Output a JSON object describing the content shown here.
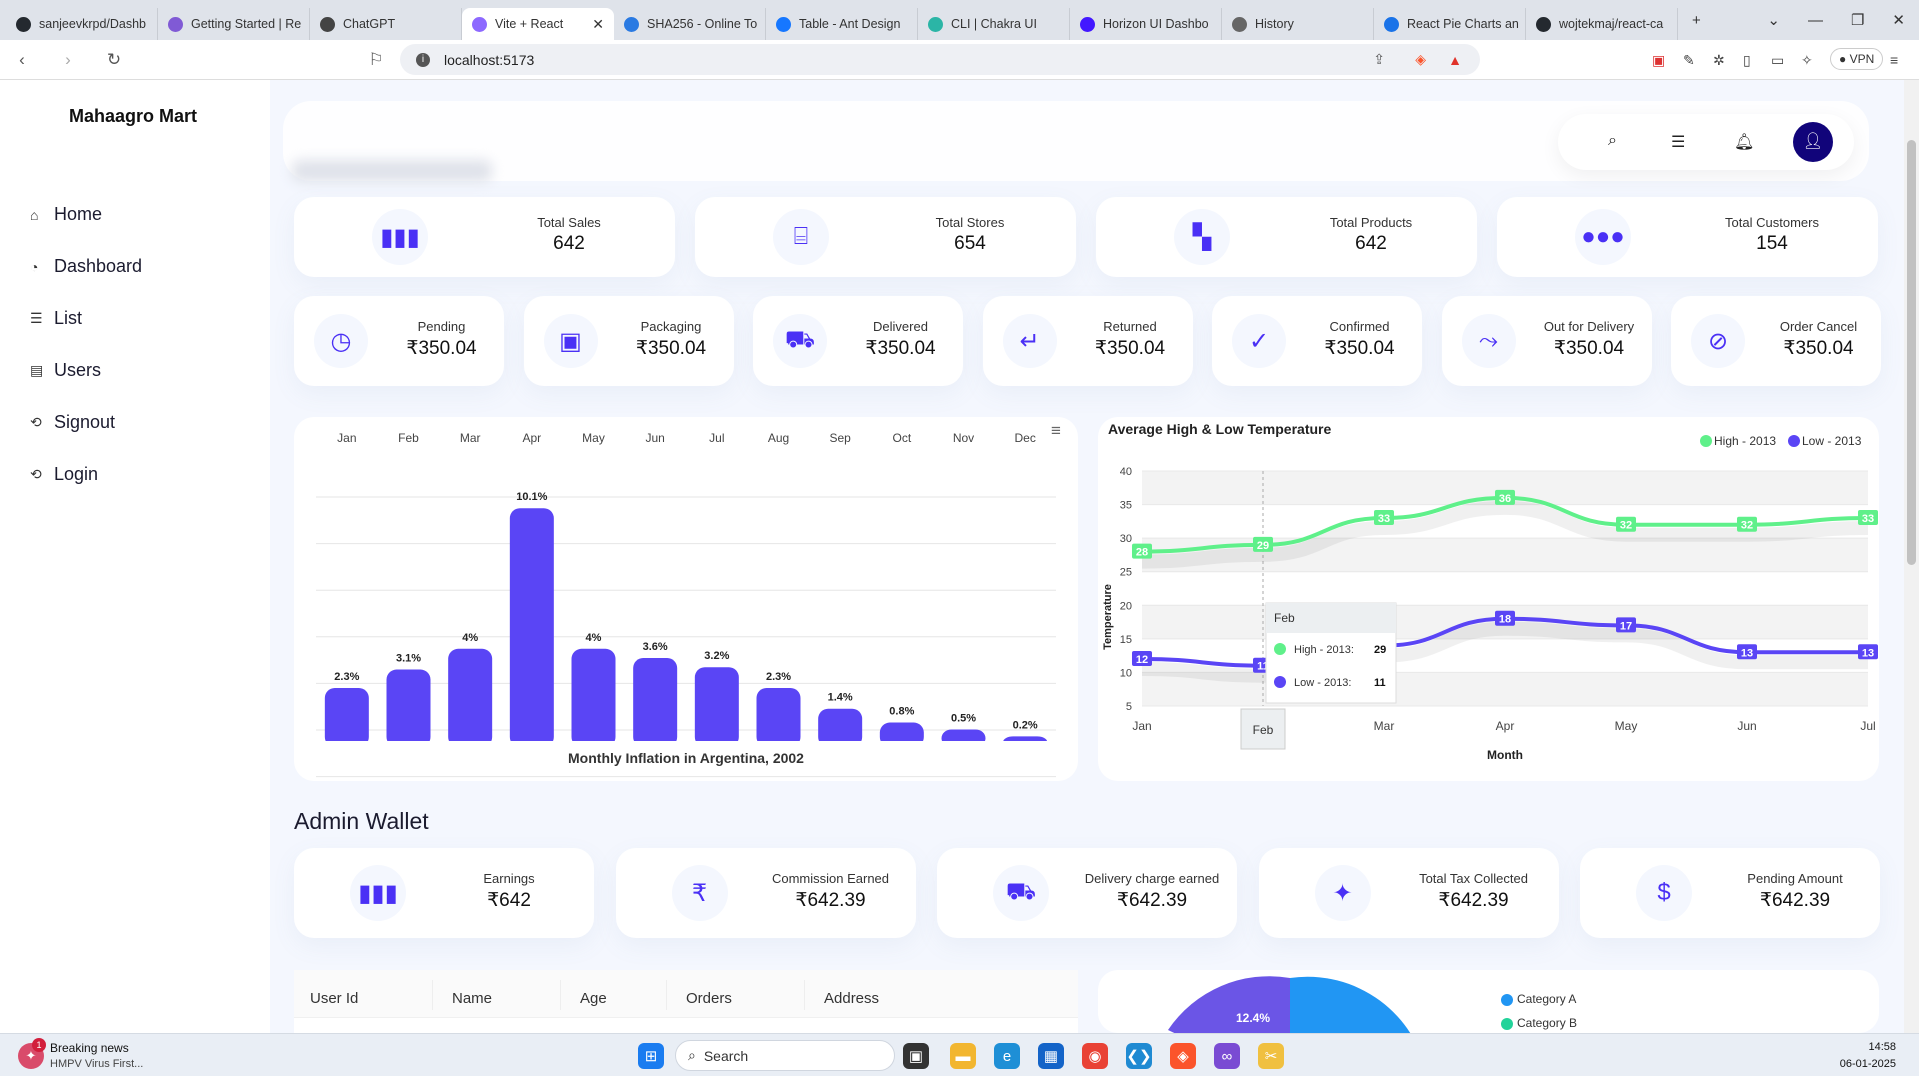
{
  "browser": {
    "tabs": [
      {
        "title": "sanjeevkrpd/Dashb",
        "color": "#24292f"
      },
      {
        "title": "Getting Started | Re",
        "color": "#805ad5"
      },
      {
        "title": "ChatGPT",
        "color": "#444"
      },
      {
        "title": "Vite + React",
        "color": "#8d69ff"
      },
      {
        "title": "SHA256 - Online To",
        "color": "#2a7ae2"
      },
      {
        "title": "Table - Ant Design",
        "color": "#1677ff"
      },
      {
        "title": "CLI | Chakra UI",
        "color": "#2bb5a6"
      },
      {
        "title": "Horizon UI Dashbo",
        "color": "#4318ff"
      },
      {
        "title": "History",
        "color": "#666"
      },
      {
        "title": "React Pie Charts an",
        "color": "#1a73e8"
      },
      {
        "title": "wojtekmaj/react-ca",
        "color": "#24292f"
      }
    ],
    "url": "localhost:5173",
    "vpn": "VPN"
  },
  "sidebar": {
    "brand": "Mahaagro Mart",
    "items": [
      {
        "label": "Home",
        "icon": "home-icon",
        "glyph": "⌂"
      },
      {
        "label": "Dashboard",
        "icon": "dashboard-icon",
        "glyph": "◔"
      },
      {
        "label": "List",
        "icon": "list-icon",
        "glyph": "☰"
      },
      {
        "label": "Users",
        "icon": "users-icon",
        "glyph": "▤"
      },
      {
        "label": "Signout",
        "icon": "signout-icon",
        "glyph": "⟲"
      },
      {
        "label": "Login",
        "icon": "login-icon",
        "glyph": "⟲"
      }
    ]
  },
  "summary_cards": [
    {
      "label": "Total Sales",
      "value": "642",
      "icon": "bar-chart-icon",
      "glyph": "▮▮▮"
    },
    {
      "label": "Total Stores",
      "value": "654",
      "icon": "store-icon",
      "glyph": "⌸"
    },
    {
      "label": "Total Products",
      "value": "642",
      "icon": "products-icon",
      "glyph": "▚"
    },
    {
      "label": "Total Customers",
      "value": "154",
      "icon": "customers-icon",
      "glyph": "●●●"
    }
  ],
  "order_cards": [
    {
      "label": "Pending",
      "value": "₹350.04",
      "icon": "pending-icon",
      "glyph": "◷"
    },
    {
      "label": "Packaging",
      "value": "₹350.04",
      "icon": "package-icon",
      "glyph": "▣"
    },
    {
      "label": "Delivered",
      "value": "₹350.04",
      "icon": "truck-icon",
      "glyph": "⛟"
    },
    {
      "label": "Returned",
      "value": "₹350.04",
      "icon": "return-icon",
      "glyph": "↵"
    },
    {
      "label": "Confirmed",
      "value": "₹350.04",
      "icon": "check-circle-icon",
      "glyph": "✓"
    },
    {
      "label": "Out for Delivery",
      "value": "₹350.04",
      "icon": "route-icon",
      "glyph": "⤳"
    },
    {
      "label": "Order Cancel",
      "value": "₹350.04",
      "icon": "cancel-icon",
      "glyph": "⊘"
    }
  ],
  "admin_wallet": {
    "title": "Admin Wallet",
    "cards": [
      {
        "label": "Earnings",
        "value": "₹642",
        "icon": "bar-chart-icon",
        "glyph": "▮▮▮"
      },
      {
        "label": "Commission Earned",
        "value": "₹642.39",
        "icon": "rupee-icon",
        "glyph": "₹"
      },
      {
        "label": "Delivery charge earned",
        "value": "₹642.39",
        "icon": "delivery-van-icon",
        "glyph": "⛟"
      },
      {
        "label": "Total Tax Collected",
        "value": "₹642.39",
        "icon": "money-icon",
        "glyph": "✦"
      },
      {
        "label": "Pending Amount",
        "value": "₹642.39",
        "icon": "money-bag-icon",
        "glyph": "$"
      }
    ]
  },
  "table": {
    "headers": [
      "User Id",
      "Name",
      "Age",
      "Orders",
      "Address"
    ]
  },
  "chart_data": [
    {
      "type": "bar",
      "title": "Monthly Inflation in Argentina, 2002",
      "categories": [
        "Jan",
        "Feb",
        "Mar",
        "Apr",
        "May",
        "Jun",
        "Jul",
        "Aug",
        "Sep",
        "Oct",
        "Nov",
        "Dec"
      ],
      "values": [
        2.3,
        3.1,
        4.0,
        10.1,
        4.0,
        3.6,
        3.2,
        2.3,
        1.4,
        0.8,
        0.5,
        0.2
      ],
      "value_labels": [
        "2.3%",
        "3.1%",
        "4%",
        "10.1%",
        "4%",
        "3.6%",
        "3.2%",
        "2.3%",
        "1.4%",
        "0.8%",
        "0.5%",
        "0.2%"
      ],
      "ylim": [
        0,
        10.5
      ],
      "bar_color": "#5a45f5"
    },
    {
      "type": "line",
      "title": "Average High & Low Temperature",
      "xlabel": "Month",
      "ylabel": "Temperature",
      "categories": [
        "Jan",
        "Feb",
        "Mar",
        "Apr",
        "May",
        "Jun",
        "Jul"
      ],
      "yticks": [
        5,
        10,
        15,
        20,
        25,
        30,
        35,
        40
      ],
      "ylim": [
        5,
        40
      ],
      "series": [
        {
          "name": "High - 2013",
          "values": [
            28,
            29,
            33,
            36,
            32,
            32,
            33
          ],
          "color": "#5ff08a"
        },
        {
          "name": "Low - 2013",
          "values": [
            12,
            11,
            14,
            18,
            17,
            13,
            13
          ],
          "color": "#5a45f5"
        }
      ],
      "legend": "top-right",
      "tooltip": {
        "title": "Feb",
        "rows": [
          {
            "label": "High - 2013:",
            "value": "29"
          },
          {
            "label": "Low - 2013:",
            "value": "11"
          }
        ]
      },
      "crosshair_label": "Feb"
    },
    {
      "type": "pie",
      "legend": [
        "Category A",
        "Category B"
      ],
      "visible_label": "12.4%",
      "colors": [
        "#2196f3",
        "#6b55e6",
        "#22d39a"
      ]
    }
  ],
  "taskbar": {
    "news_title": "Breaking news",
    "news_sub": "HMPV Virus First...",
    "news_badge": "1",
    "search": "Search",
    "time": "14:58",
    "date": "06-01-2025"
  }
}
